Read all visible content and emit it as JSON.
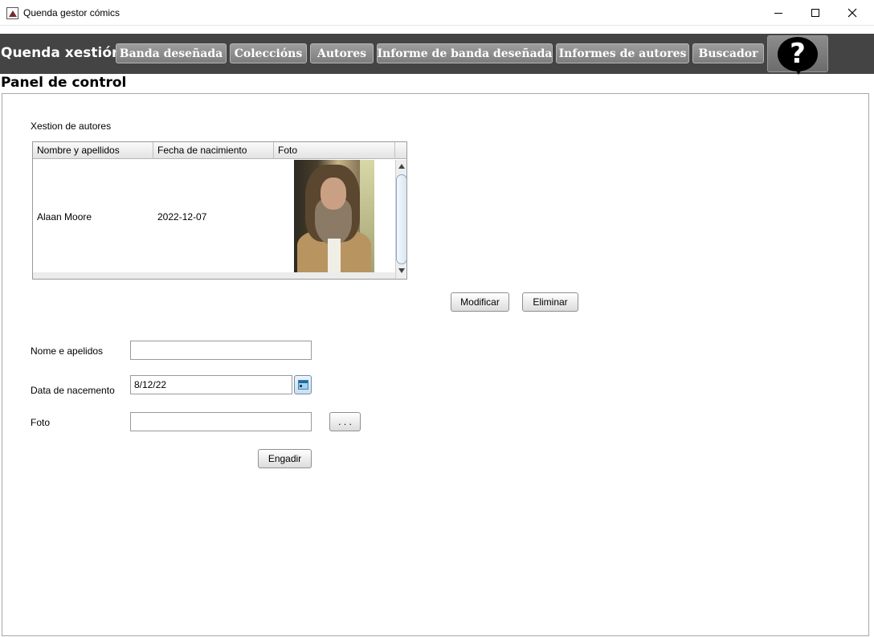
{
  "window": {
    "title": "Quenda gestor cómics"
  },
  "menubar": {
    "brand": "Quenda xestión",
    "items": [
      {
        "label": "Banda deseñada"
      },
      {
        "label": "Coleccións"
      },
      {
        "label": "Autores"
      },
      {
        "label": "Informe de banda deseñada"
      },
      {
        "label": "Informes de autores"
      },
      {
        "label": "Buscador"
      }
    ],
    "help_glyph": "?"
  },
  "panel": {
    "title": "Panel de control",
    "section_label": "Xestion de autores"
  },
  "table": {
    "columns": [
      "Nombre y apellidos",
      "Fecha de nacimiento",
      "Foto"
    ],
    "rows": [
      {
        "name": "Alaan Moore",
        "birth_date": "2022-12-07",
        "photo": "author-photo"
      }
    ]
  },
  "actions": {
    "modify_label": "Modificar",
    "delete_label": "Eliminar"
  },
  "form": {
    "name_label": "Nome e apelidos",
    "name_value": "",
    "date_label": "Data de nacemento",
    "date_value": "8/12/22",
    "photo_label": "Foto",
    "photo_value": "",
    "browse_label": ". . .",
    "add_label": "Engadir"
  },
  "icons": {
    "help": "help-icon",
    "calendar": "calendar-icon",
    "app": "app-icon"
  },
  "colors": {
    "menubar_bg": "#444444",
    "nav_button": "#8e8e8e",
    "panel_border": "#a8a8a8"
  }
}
